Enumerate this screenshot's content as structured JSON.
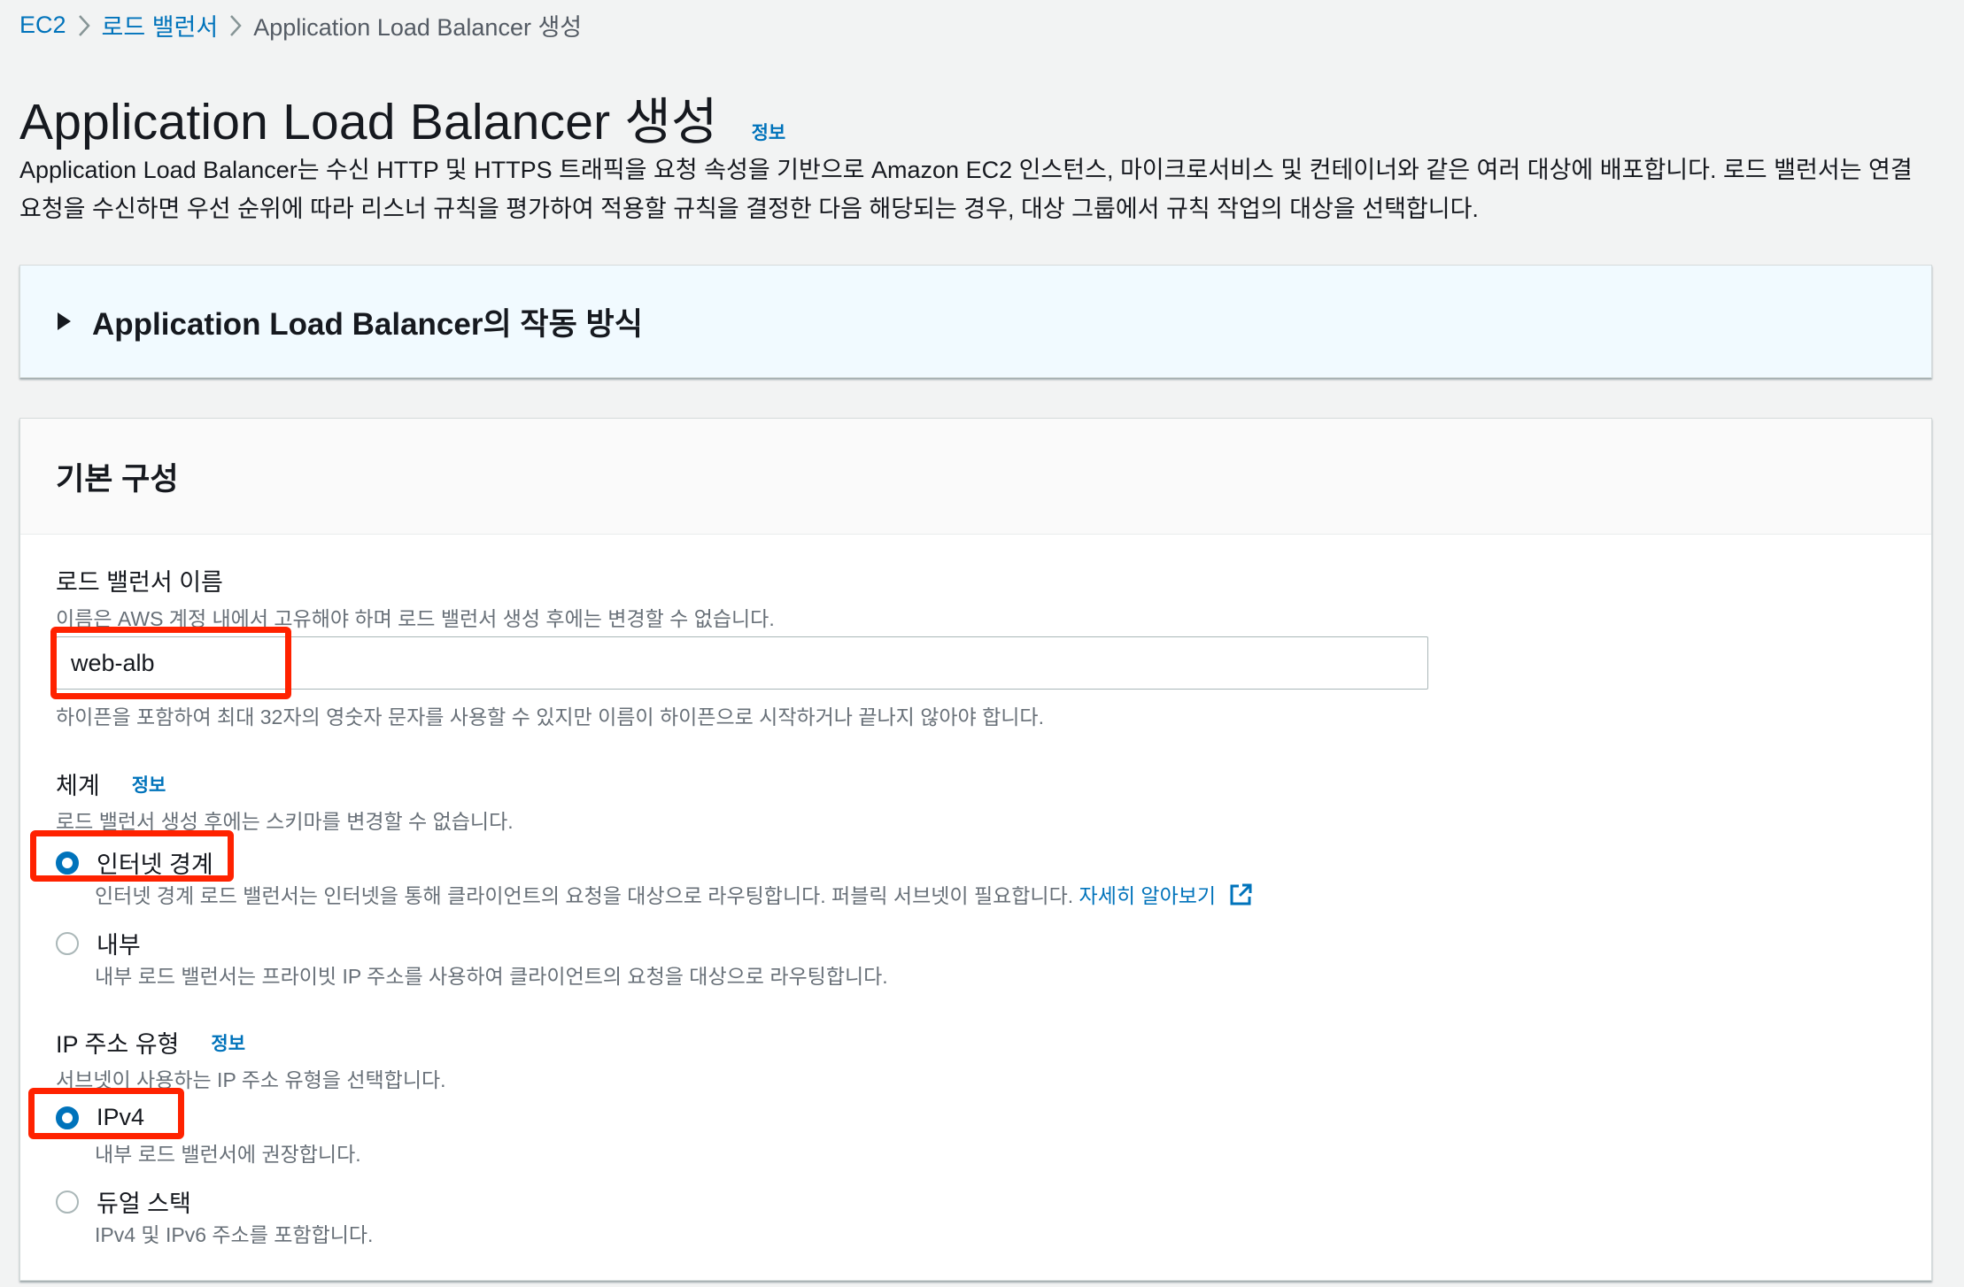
{
  "breadcrumb": {
    "items": [
      "EC2",
      "로드 밸런서"
    ],
    "current": "Application Load Balancer 생성"
  },
  "page": {
    "title": "Application Load Balancer 생성",
    "info_label": "정보",
    "description": "Application Load Balancer는 수신 HTTP 및 HTTPS 트래픽을 요청 속성을 기반으로 Amazon EC2 인스턴스, 마이크로서비스 및 컨테이너와 같은 여러 대상에 배포합니다. 로드 밸런서는 연결 요청을 수신하면 우선 순위에 따라 리스너 규칙을 평가하여 적용할 규칙을 결정한 다음 해당되는 경우, 대상 그룹에서 규칙 작업의 대상을 선택합니다."
  },
  "how_it_works": {
    "title": "Application Load Balancer의 작동 방식",
    "expanded": false
  },
  "basic_config": {
    "title": "기본 구성",
    "name_field": {
      "label": "로드 밸런서 이름",
      "hint": "이름은 AWS 계정 내에서 고유해야 하며 로드 밸런서 생성 후에는 변경할 수 없습니다.",
      "value": "web-alb",
      "constraint": "하이픈을 포함하여 최대 32자의 영숫자 문자를 사용할 수 있지만 이름이 하이픈으로 시작하거나 끝나지 않아야 합니다."
    },
    "scheme": {
      "label": "체계",
      "info_label": "정보",
      "hint": "로드 밸런서 생성 후에는 스키마를 변경할 수 없습니다.",
      "options": [
        {
          "label": "인터넷 경계",
          "description": "인터넷 경계 로드 밸런서는 인터넷을 통해 클라이언트의 요청을 대상으로 라우팅합니다. 퍼블릭 서브넷이 필요합니다.",
          "link": "자세히 알아보기",
          "selected": true
        },
        {
          "label": "내부",
          "description": "내부 로드 밸런서는 프라이빗 IP 주소를 사용하여 클라이언트의 요청을 대상으로 라우팅합니다.",
          "selected": false
        }
      ]
    },
    "ip_type": {
      "label": "IP 주소 유형",
      "info_label": "정보",
      "hint": "서브넷이 사용하는 IP 주소 유형을 선택합니다.",
      "options": [
        {
          "label": "IPv4",
          "description": "내부 로드 밸런서에 권장합니다.",
          "selected": true
        },
        {
          "label": "듀얼 스택",
          "description": "IPv4 및 IPv6 주소를 포함합니다.",
          "selected": false
        }
      ]
    }
  },
  "colors": {
    "link": "#0073bb",
    "highlight": "#ff2200",
    "info_panel_bg": "#f1faff"
  }
}
